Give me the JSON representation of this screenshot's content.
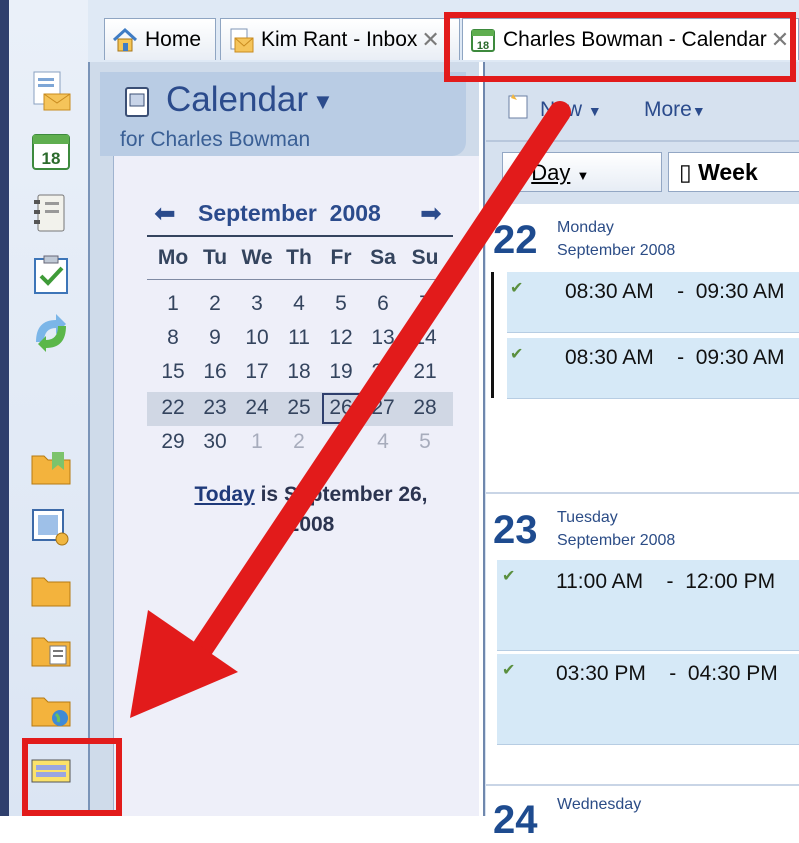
{
  "tabs": [
    {
      "label": "Home",
      "icon": "home-icon"
    },
    {
      "label": "Kim Rant - Inbox",
      "icon": "inbox-icon"
    },
    {
      "label": "Charles Bowman - Calendar",
      "icon": "calendar-icon"
    }
  ],
  "calendar_panel": {
    "title": "Calendar",
    "subtitle": "for Charles Bowman",
    "month": "September",
    "year": "2008",
    "weekdays": [
      "Mo",
      "Tu",
      "We",
      "Th",
      "Fr",
      "Sa",
      "Su"
    ],
    "weeks": [
      [
        "1",
        "2",
        "3",
        "4",
        "5",
        "6",
        "7"
      ],
      [
        "8",
        "9",
        "10",
        "11",
        "12",
        "13",
        "14"
      ],
      [
        "15",
        "16",
        "17",
        "18",
        "19",
        "20",
        "21"
      ],
      [
        "22",
        "23",
        "24",
        "25",
        "26",
        "27",
        "28"
      ],
      [
        "29",
        "30",
        "1",
        "2",
        "3",
        "4",
        "5"
      ]
    ],
    "selected_day": "26",
    "today_link": "Today",
    "today_text_1": " is September 26,",
    "today_text_2": "2008"
  },
  "toolbar": {
    "new_label": "New",
    "more_label": "More"
  },
  "views": {
    "day_label": "Day",
    "week_label": "Week"
  },
  "days": [
    {
      "num": "22",
      "weekday": "Monday",
      "month": "September 2008",
      "appointments": [
        {
          "start": "08:30 AM",
          "sep": "-",
          "end": "09:30 AM"
        },
        {
          "start": "08:30 AM",
          "sep": "-",
          "end": "09:30 AM"
        }
      ]
    },
    {
      "num": "23",
      "weekday": "Tuesday",
      "month": "September 2008",
      "appointments": [
        {
          "start": "11:00 AM",
          "sep": "-",
          "end": "12:00 PM"
        },
        {
          "start": "03:30 PM",
          "sep": "-",
          "end": "04:30 PM"
        }
      ]
    },
    {
      "num": "24",
      "weekday": "Wednesday",
      "month": "",
      "appointments": []
    }
  ],
  "rail_icons": [
    "mail-icon",
    "calendar-18-icon",
    "contacts-icon",
    "tasks-icon",
    "sync-icon",
    "folder-bookmark-icon",
    "grid-settings-icon",
    "folder-icon",
    "folder-list-icon",
    "folder-globe-icon",
    "bar-icon"
  ],
  "colors": {
    "accent": "#2b4b8c",
    "highlight": "#e21b1b",
    "appointment": "#d6e9f7"
  }
}
